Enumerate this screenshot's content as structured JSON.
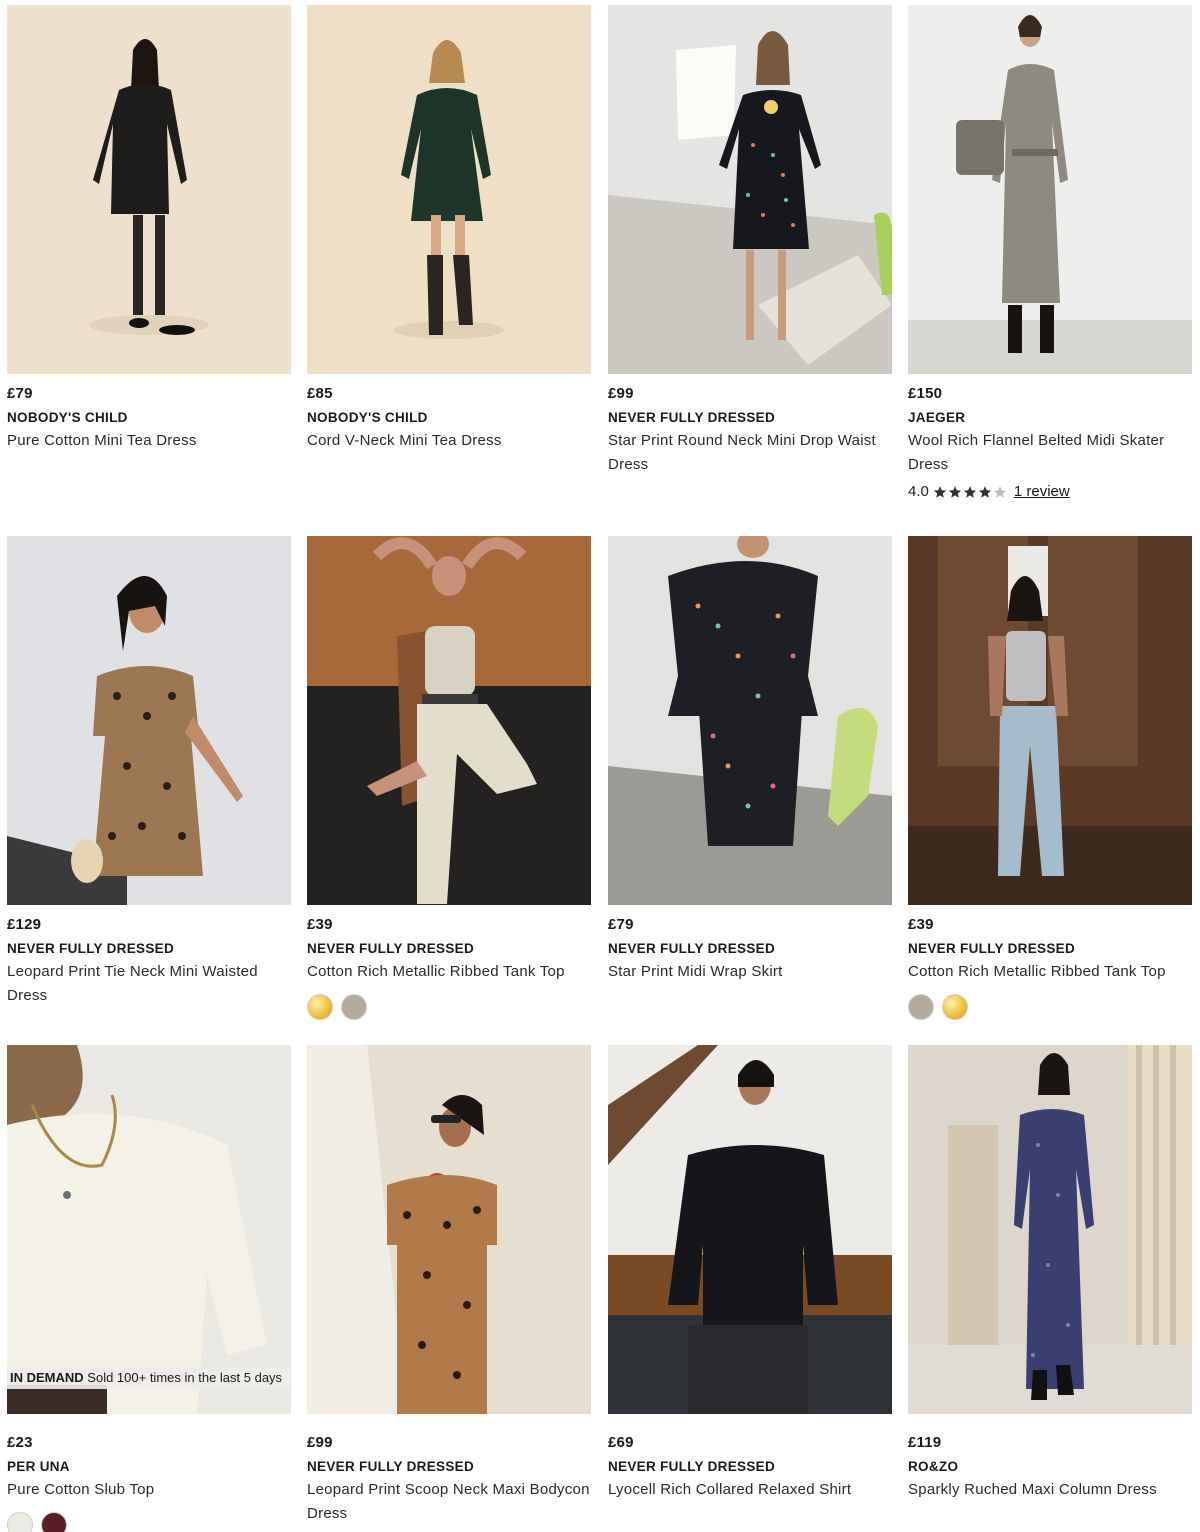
{
  "products": [
    {
      "price": "£79",
      "brand": "NOBODY'S CHILD",
      "name": "Pure Cotton Mini Tea Dress",
      "image": "model in black long-sleeve mini dress"
    },
    {
      "price": "£85",
      "brand": "NOBODY'S CHILD",
      "name": "Cord V-Neck Mini Tea Dress",
      "image": "model in green cord mini dress"
    },
    {
      "price": "£99",
      "brand": "NEVER FULLY DRESSED",
      "name": "Star Print Round Neck Mini Drop Waist Dress",
      "image": "model in star print dress"
    },
    {
      "price": "£150",
      "brand": "JAEGER",
      "name": "Wool Rich Flannel Belted Midi Skater Dress",
      "image": "model in grey flannel midi dress",
      "rating": {
        "score": "4.0",
        "stars": 4,
        "max": 5,
        "review_label": "1 review"
      }
    },
    {
      "price": "£129",
      "brand": "NEVER FULLY DRESSED",
      "name": "Leopard Print Tie Neck Mini Waisted Dress",
      "image": "model in leopard print mini dress"
    },
    {
      "price": "£39",
      "brand": "NEVER FULLY DRESSED",
      "name": "Cotton Rich Metallic Ribbed Tank Top",
      "image": "model in metallic tank top",
      "swatches": [
        "#f0c040",
        "#b3aa9c"
      ]
    },
    {
      "price": "£79",
      "brand": "NEVER FULLY DRESSED",
      "name": "Star Print Midi Wrap Skirt",
      "image": "model in star print midi skirt"
    },
    {
      "price": "£39",
      "brand": "NEVER FULLY DRESSED",
      "name": "Cotton Rich Metallic Ribbed Tank Top",
      "image": "model in silver tank top and jeans",
      "swatches": [
        "#b3aa9c",
        "#f0c040"
      ]
    },
    {
      "price": "£23",
      "brand": "PER UNA",
      "name": "Pure Cotton Slub Top",
      "image": "model in cream slub top",
      "badge": {
        "label": "IN DEMAND",
        "text": "Sold 100+ times in the last 5 days"
      },
      "swatches": [
        "#ecebe3",
        "#5a1c26"
      ]
    },
    {
      "price": "£99",
      "brand": "NEVER FULLY DRESSED",
      "name": "Leopard Print Scoop Neck Maxi Bodycon Dress",
      "image": "model in leopard maxi dress"
    },
    {
      "price": "£69",
      "brand": "NEVER FULLY DRESSED",
      "name": "Lyocell Rich Collared Relaxed Shirt",
      "image": "model in black relaxed shirt"
    },
    {
      "price": "£119",
      "brand": "RO&ZO",
      "name": "Sparkly Ruched Maxi Column Dress",
      "image": "model in sparkly navy maxi dress"
    }
  ],
  "colors": {
    "text": "#1a1a1a",
    "star": "#333333",
    "star_empty": "#bdbdbd"
  }
}
